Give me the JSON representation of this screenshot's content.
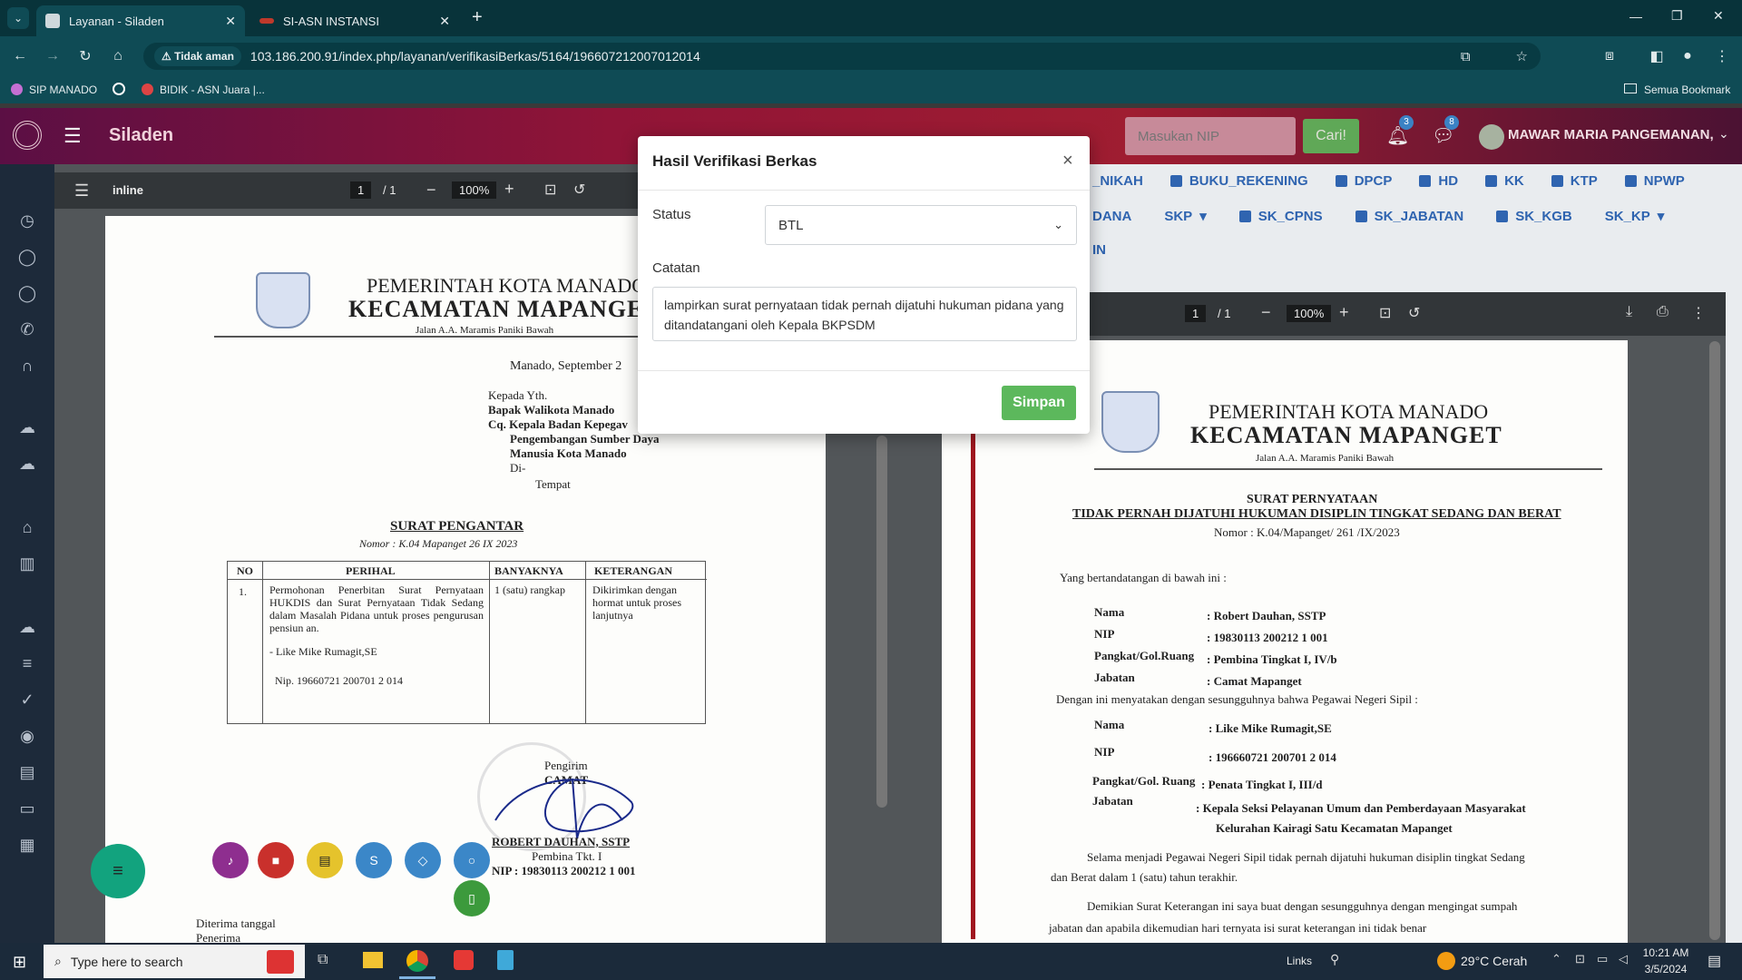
{
  "browser": {
    "tabs": [
      {
        "title": "Layanan - Siladen",
        "active": true
      },
      {
        "title": "SI-ASN INSTANSI",
        "active": false
      }
    ],
    "security_label": "Tidak aman",
    "url": "103.186.200.91/index.php/layanan/verifikasiBerkas/5164/196607212007012014",
    "bookmarks": [
      "SIP MANADO",
      "BIDIK - ASN Juara |..."
    ],
    "all_bookmarks": "Semua Bookmark"
  },
  "app": {
    "title": "Siladen",
    "nip_placeholder": "Masukan NIP",
    "search_button": "Cari!",
    "notif_count": "3",
    "msg_count": "8",
    "user_name": "MAWAR MARIA PANGEMANAN,",
    "accent": "#5cb85c"
  },
  "doc_tabs": {
    "row1": [
      "_NIKAH",
      "BUKU_REKENING",
      "DPCP",
      "HD",
      "KK",
      "KTP",
      "NPWP"
    ],
    "row2_prefix": "DANA",
    "row2": [
      "SKP",
      "SK_CPNS",
      "SK_JABATAN",
      "SK_KGB",
      "SK_KP"
    ],
    "row3": "IN"
  },
  "pdf_left": {
    "name": "inline",
    "page": "1",
    "pages": "/ 1",
    "zoom": "100%",
    "header1": "PEMERINTAH KOTA MANADO",
    "header2": "KECAMATAN MAPANGET",
    "address": "Jalan A.A. Maramis Paniki Bawah",
    "date_line": "Manado, September 2",
    "kepada": "Kepada Yth.",
    "to1": "Bapak Walikota Manado",
    "to2": "Cq. Kepala Badan Kepegav",
    "to3": "Pengembangan Sumber Daya",
    "to4": "Manusia Kota Manado",
    "to5": "Di-",
    "to6": "Tempat",
    "title": "SURAT PENGANTAR",
    "nomor": "Nomor : K.04 Mapanget 26 IX 2023",
    "table_headers": [
      "NO",
      "PERIHAL",
      "BANYAKNYA",
      "KETERANGAN"
    ],
    "row_no": "1.",
    "row_perihal": "Permohonan Penerbitan Surat Pernyataan HUKDIS dan Surat Pernyataan Tidak Sedang dalam Masalah Pidana untuk proses pengurusan pensiun an.",
    "row_perihal2": "- Like Mike Rumagit,SE",
    "row_nip": "Nip. 19660721 200701 2 014",
    "row_banyak": "1 (satu) rangkap",
    "row_ket": "Dikirimkan dengan hormat untuk proses lanjutnya",
    "pengirim": "Pengirim",
    "camat": "CAMAT",
    "signer": "ROBERT DAUHAN, SSTP",
    "pangkat": "Pembina Tkt. I",
    "signer_nip": "NIP : 19830113 200212 1 001",
    "diterima": "Diterima tanggal",
    "penerima": "Penerima"
  },
  "pdf_right": {
    "page": "1",
    "pages": "/ 1",
    "zoom": "100%",
    "header1": "PEMERINTAH KOTA MANADO",
    "header2": "KECAMATAN MAPANGET",
    "address": "Jalan A.A. Maramis Paniki Bawah",
    "title": "SURAT PERNYATAAN",
    "subtitle": "TIDAK PERNAH DIJATUHI HUKUMAN DISIPLIN TINGKAT SEDANG DAN BERAT",
    "nomor": "Nomor : K.04/Mapanget/ 261 /IX/2023",
    "intro": "Yang bertandatangan di bawah ini :",
    "fields1": [
      {
        "k": "Nama",
        "v": ": Robert Dauhan, SSTP"
      },
      {
        "k": "NIP",
        "v": ": 19830113 200212 1 001"
      },
      {
        "k": "Pangkat/Gol.Ruang",
        "v": ": Pembina Tingkat I, IV/b"
      },
      {
        "k": "Jabatan",
        "v": ": Camat Mapanget"
      }
    ],
    "mid": "Dengan ini menyatakan dengan sesungguhnya bahwa Pegawai Negeri Sipil :",
    "fields2": [
      {
        "k": "Nama",
        "v": ": Like Mike Rumagit,SE"
      },
      {
        "k": "NIP",
        "v": ": 196660721 200701 2 014"
      },
      {
        "k": "Pangkat/Gol. Ruang",
        "v": ": Penata Tingkat I, III/d"
      },
      {
        "k": "Jabatan",
        "v": ": Kepala Seksi Pelayanan Umum dan Pemberdayaan Masyarakat"
      }
    ],
    "jabatan2": "Kelurahan Kairagi Satu Kecamatan Mapanget",
    "para1": "Selama menjadi Pegawai Negeri Sipil tidak pernah dijatuhi hukuman disiplin tingkat Sedang",
    "para1b": "dan Berat dalam 1 (satu) tahun terakhir.",
    "para2": "Demikian Surat Keterangan ini saya buat dengan sesungguhnya dengan mengingat sumpah",
    "para2b": "jabatan dan apabila dikemudian hari ternyata isi surat keterangan ini tidak benar"
  },
  "modal": {
    "title": "Hasil Verifikasi Berkas",
    "status_label": "Status",
    "status_value": "BTL",
    "notes_label": "Catatan",
    "notes_value": "lampirkan surat pernyataan tidak pernah dijatuhi hukuman pidana yang ditandatangani oleh Kepala BKPSDM",
    "save_button": "Simpan"
  },
  "taskbar": {
    "search_placeholder": "Type here to search",
    "links": "Links",
    "weather": "29°C  Cerah",
    "time": "10:21 AM",
    "date": "3/5/2024"
  }
}
